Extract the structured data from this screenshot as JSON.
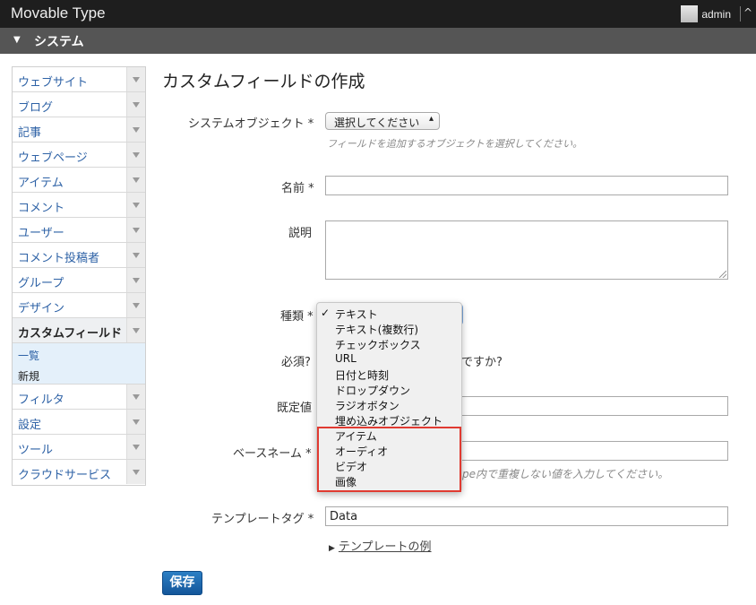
{
  "header": {
    "brand": "Movable Type",
    "username": "admin",
    "expand_glyph": "^"
  },
  "system_bar": {
    "title": "システム",
    "caret": "▼"
  },
  "sidebar": {
    "items": [
      {
        "label": "ウェブサイト"
      },
      {
        "label": "ブログ"
      },
      {
        "label": "記事"
      },
      {
        "label": "ウェブページ"
      },
      {
        "label": "アイテム"
      },
      {
        "label": "コメント"
      },
      {
        "label": "ユーザー"
      },
      {
        "label": "コメント投稿者"
      },
      {
        "label": "グループ"
      },
      {
        "label": "デザイン"
      },
      {
        "label": "カスタムフィールド"
      },
      {
        "label": "フィルタ"
      },
      {
        "label": "設定"
      },
      {
        "label": "ツール"
      },
      {
        "label": "クラウドサービス"
      }
    ],
    "active_sub": {
      "list": "一覧",
      "new": "新規"
    }
  },
  "page": {
    "title": "カスタムフィールドの作成"
  },
  "form": {
    "object_label": "システムオブジェクト",
    "object_value": "選択してください",
    "object_hint": "フィールドを追加するオブジェクトを選択してください。",
    "name_label": "名前",
    "description_label": "説明",
    "type_label": "種類",
    "required_label": "必須?",
    "required_tail": "ですか?",
    "default_label": "既定値",
    "basename_label": "ベースネーム",
    "basename_hint_tail": "pe内で重複しない値を入力してください。",
    "tag_label": "テンプレートタグ",
    "tag_value": "Data",
    "template_example": "テンプレートの例",
    "required_mark": "*",
    "save": "保存"
  },
  "type_dropdown": {
    "selected_check": "✓",
    "options": [
      "テキスト",
      "テキスト(複数行)",
      "チェックボックス",
      "URL",
      "日付と時刻",
      "ドロップダウン",
      "ラジオボタン",
      "埋め込みオブジェクト",
      "アイテム",
      "オーディオ",
      "ビデオ",
      "画像"
    ]
  },
  "colors": {
    "accent": "#14569a",
    "link": "#2e62a6",
    "highlight": "#e03a31"
  }
}
